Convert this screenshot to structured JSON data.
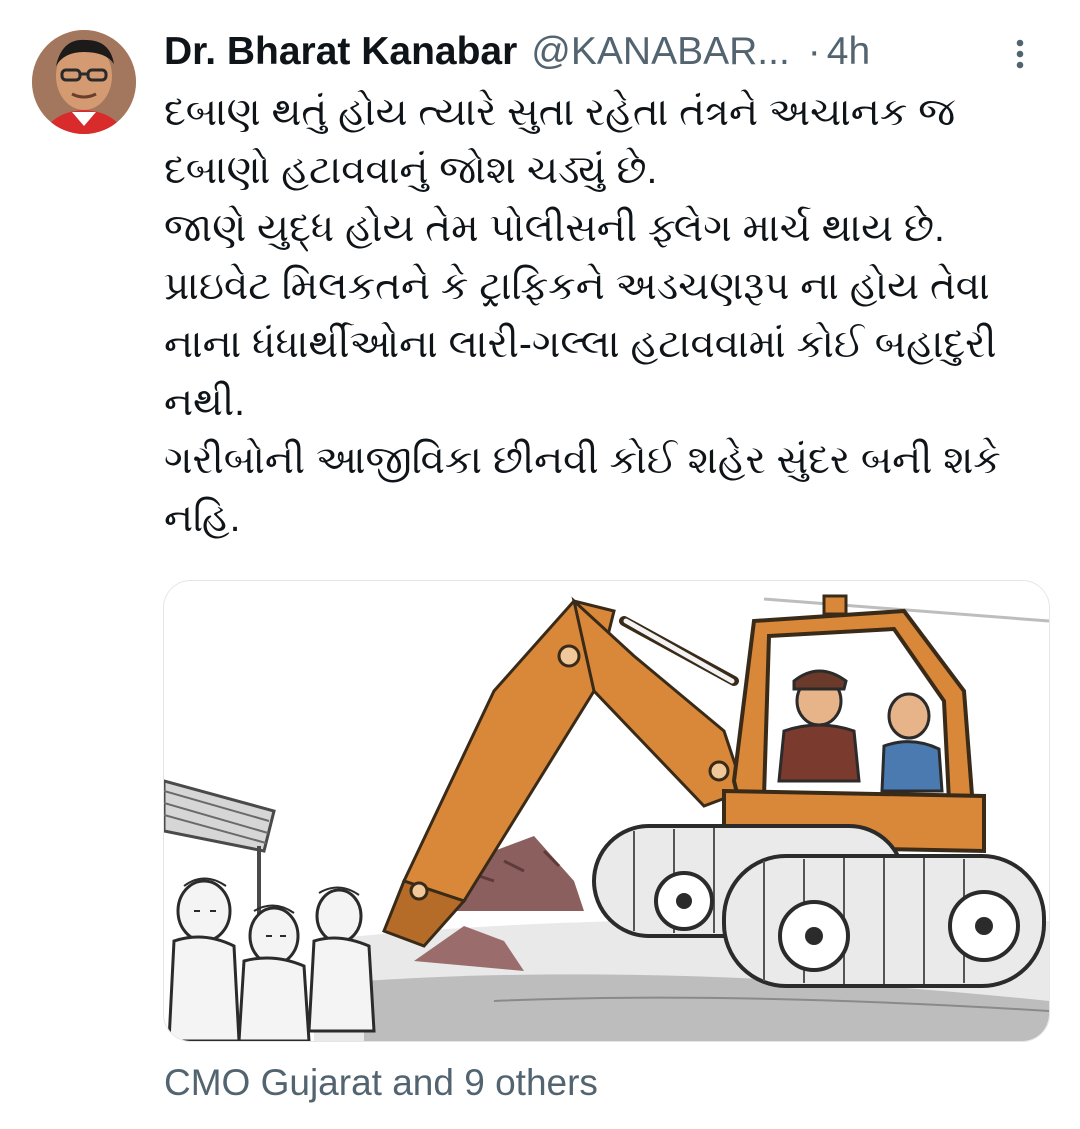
{
  "tweet": {
    "author": {
      "display_name": "Dr. Bharat Kanabar",
      "handle": "@KANABAR...",
      "avatar": "profile-photo"
    },
    "separator": "·",
    "time": "4h",
    "more_icon": "more-vertical-icon",
    "text_lines": [
      "દબાણ થતું હોય ત્યારે સુતા રહેતા તંત્રને અચાનક જ",
      "દબાણો હટાવવાનું જોશ ચડ્યું છે.",
      "જાણે યુદ્ધ હોય તેમ પોલીસની ફ્લેગ માર્ચ થાય છે.",
      "પ્રાઇવેટ મિલકતને કે ટ્રાફિકને અડચણરૂપ ના હોય તેવા",
      "નાના ધંધાર્થીઓના લારી-ગલ્લા હટાવવામાં કોઈ બહાદુરી",
      "નથી.",
      "ગરીબોની આજીવિકા છીનવી કોઈ શહેર સુંદર બની શકે",
      "નહિ."
    ],
    "media": {
      "type": "cartoon-image",
      "subject": "excavator-demolishing-street-vendor-stalls"
    },
    "liked_by": "CMO Gujarat and 9 others"
  },
  "colors": {
    "text_primary": "#0f1419",
    "text_secondary": "#536471",
    "excavator_orange": "#d9883a",
    "border": "#e1e6ea"
  }
}
